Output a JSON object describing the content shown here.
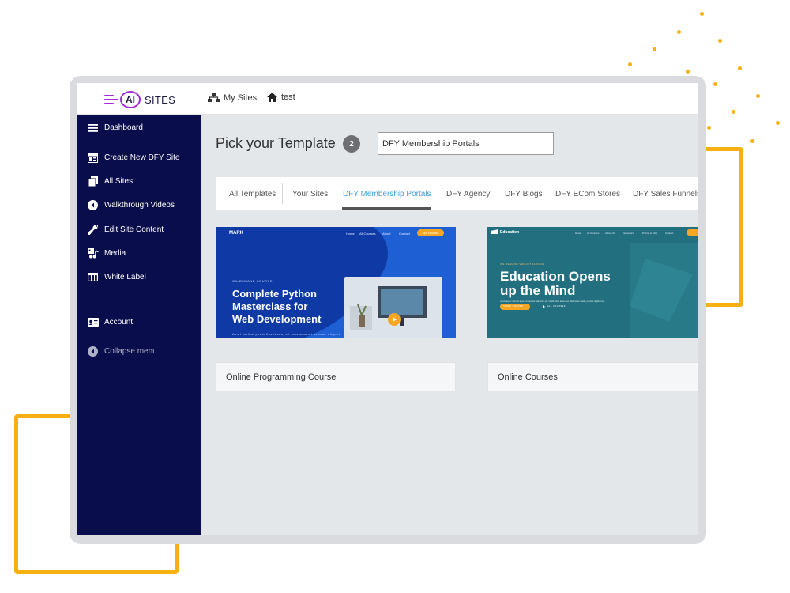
{
  "brand": {
    "logo_ai": "AI",
    "logo_word": "SITES"
  },
  "breadcrumb": {
    "my_sites": "My Sites",
    "current": "test"
  },
  "sidebar": {
    "items": [
      {
        "label": "Dashboard",
        "icon": "hamburger-icon"
      },
      {
        "label": "Create New DFY Site",
        "icon": "template-icon"
      },
      {
        "label": "All Sites",
        "icon": "copy-icon"
      },
      {
        "label": "Walkthrough Videos",
        "icon": "play-circle-icon"
      },
      {
        "label": "Edit Site Content",
        "icon": "wrench-icon"
      },
      {
        "label": "Media",
        "icon": "media-icon"
      },
      {
        "label": "White Label",
        "icon": "table-icon"
      },
      {
        "label": "Account",
        "icon": "id-card-icon"
      },
      {
        "label": "Collapse menu",
        "icon": "collapse-icon"
      }
    ]
  },
  "main": {
    "title": "Pick your Template",
    "step": "2",
    "search_value": "DFY Membership Portals",
    "tabs": [
      {
        "label": "All Templates"
      },
      {
        "label": "Your Sites"
      },
      {
        "label": "DFY Membership Portals",
        "active": true
      },
      {
        "label": "DFY Agency"
      },
      {
        "label": "DFY Blogs"
      },
      {
        "label": "DFY ECom Stores"
      },
      {
        "label": "DFY Sales Funnels"
      }
    ],
    "cards": [
      {
        "label": "Online Programming Course",
        "preview": {
          "brand": "MARK",
          "nav": [
            "Home",
            "All Courses",
            "About",
            "Contact"
          ],
          "nav_button": "GET STARTED",
          "eyebrow": "ON-DEMAND COURSE",
          "heading_lines": [
            "Complete Python",
            "Masterclass for",
            "Web Development"
          ],
          "blurb": "Amet facilisi phasellus lacus, sit massa amet aenean aliquet"
        }
      },
      {
        "label": "Online Courses",
        "preview": {
          "brand": "Education",
          "nav": [
            "Home",
            "All Courses",
            "About Us",
            "Instructors",
            "Pricing & FAQ",
            "Contact"
          ],
          "eyebrow": "ON-DEMAND VIDEO TRAINING",
          "heading_lines": [
            "Education Opens",
            "up the Mind"
          ],
          "blurb": "Lorem ipsum dolor sit amet, consectetur adipiscing elit. Ut elit tellus, luctus nec ullamcorper mattis, pulvinar dapibus leo.",
          "cta": "START COURSE",
          "secondary_cta": "ALL COURSES"
        }
      }
    ]
  },
  "colors": {
    "sidebar_bg": "#0a0d4b",
    "accent_blue": "#3da0d6",
    "deco_orange": "#f7b011",
    "logo_purple": "#a22bd6"
  }
}
